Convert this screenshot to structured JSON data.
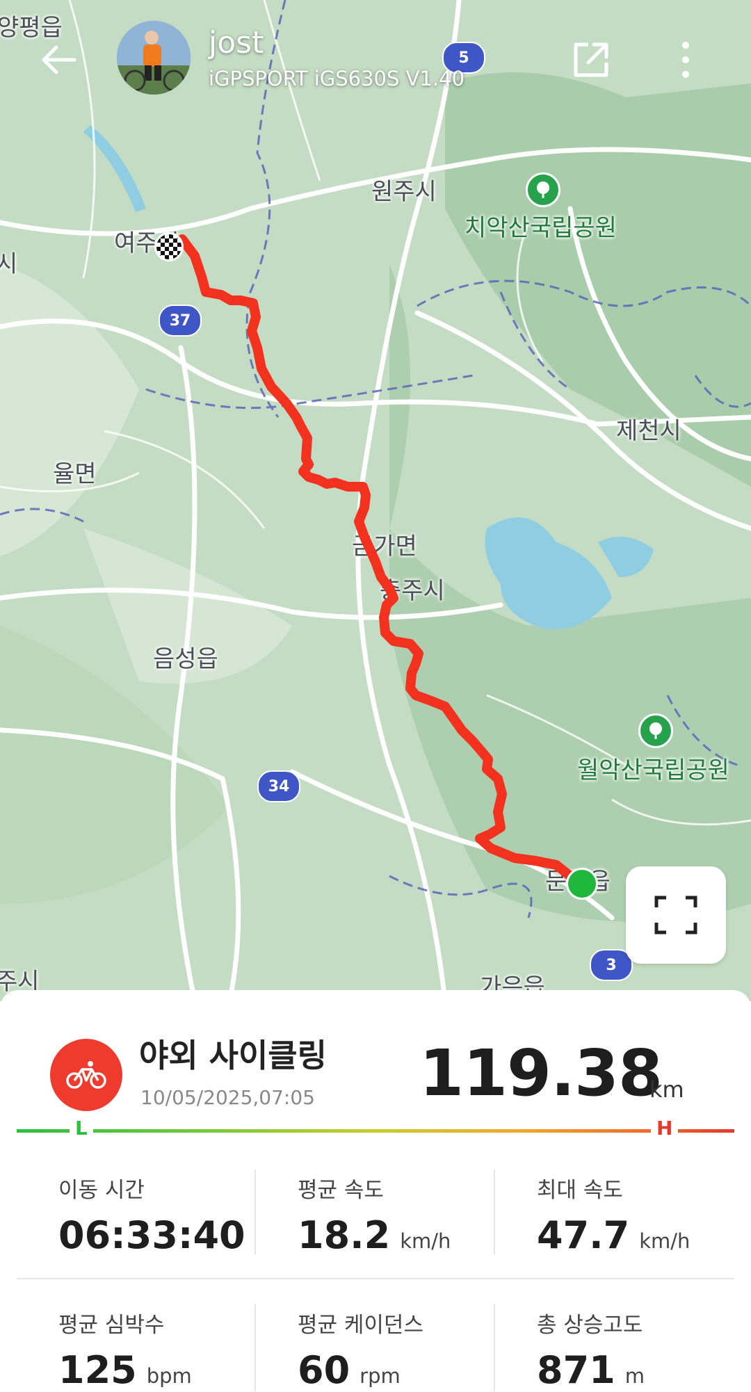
{
  "header": {
    "user_name": "jost",
    "device": "iGPSPORT iGS630S  V1.40"
  },
  "map": {
    "labels": {
      "wonju": "원주시",
      "chiak": "치악산국립공원",
      "yeoju": "여주시",
      "jecheon": "제천시",
      "yulmyeon": "율면",
      "geumga": "금가면",
      "chungju": "충주시",
      "eumseong": "음성읍",
      "woraksan": "월악산국립공원",
      "mungyeong": "문경읍",
      "gaeun": "가은읍",
      "topleft": "양평읍",
      "left_edge": "시",
      "bottomleft": "주시"
    },
    "shields": {
      "r5": "5",
      "r37": "37",
      "r34": "34",
      "r3": "3"
    }
  },
  "activity": {
    "title": "야외 사이클링",
    "date": "10/05/2025,07:05",
    "distance": "119.38",
    "distance_unit": "km",
    "gradient_low": "L",
    "gradient_high": "H"
  },
  "stats": [
    {
      "label": "이동 시간",
      "value": "06:33:40",
      "unit": ""
    },
    {
      "label": "평균 속도",
      "value": "18.2",
      "unit": "km/h"
    },
    {
      "label": "최대 속도",
      "value": "47.7",
      "unit": "km/h"
    },
    {
      "label": "평균 심박수",
      "value": "125",
      "unit": "bpm"
    },
    {
      "label": "평균 케이던스",
      "value": "60",
      "unit": "rpm"
    },
    {
      "label": "총 상승고도",
      "value": "871",
      "unit": "m"
    }
  ],
  "colors": {
    "route": "#f2321f",
    "start": "#1fb83c",
    "accent": "#ef3b2d"
  }
}
